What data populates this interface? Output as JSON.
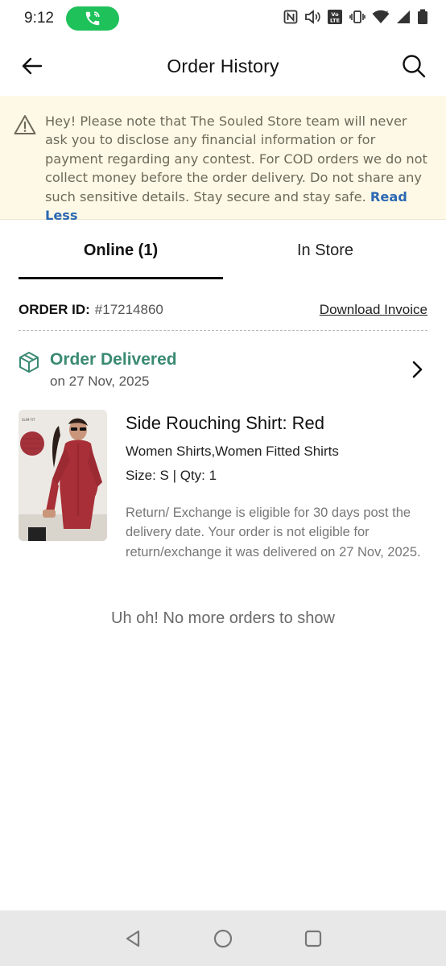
{
  "status_bar": {
    "time": "9:12",
    "icons": [
      "call-active-icon",
      "nfc-icon",
      "volume-icon",
      "volte-icon",
      "vibrate-icon",
      "wifi-icon",
      "signal-icon",
      "battery-icon"
    ]
  },
  "app_bar": {
    "title": "Order History",
    "back_icon": "back-arrow-icon",
    "search_icon": "search-icon"
  },
  "notice": {
    "text": "Hey! Please note that The Souled Store team will never ask you to disclose any financial information or for payment regarding any contest. For COD orders we do not collect money before the order delivery. Do not share any such sensitive details. Stay secure and stay safe.",
    "link": "Read Less",
    "icon": "warning-icon"
  },
  "tabs": [
    {
      "label": "Online (1)",
      "active": true
    },
    {
      "label": "In Store",
      "active": false
    }
  ],
  "order": {
    "id_label": "ORDER ID:",
    "id_value": "#17214860",
    "download_label": "Download Invoice",
    "status": "Order Delivered",
    "status_date": "on 27 Nov, 2025",
    "status_color": "#3a8a72",
    "product": {
      "name": "Side Rouching Shirt: Red",
      "category": "Women Shirts,Women Fitted Shirts",
      "size_qty": "Size: S | Qty: 1",
      "return_note": "Return/ Exchange is eligible for 30 days post the delivery date. Your order is not eligible for return/exchange it was delivered on 27 Nov, 2025."
    }
  },
  "empty_message": "Uh oh! No more orders to show",
  "nav": [
    "nav-back-icon",
    "nav-home-icon",
    "nav-recents-icon"
  ]
}
